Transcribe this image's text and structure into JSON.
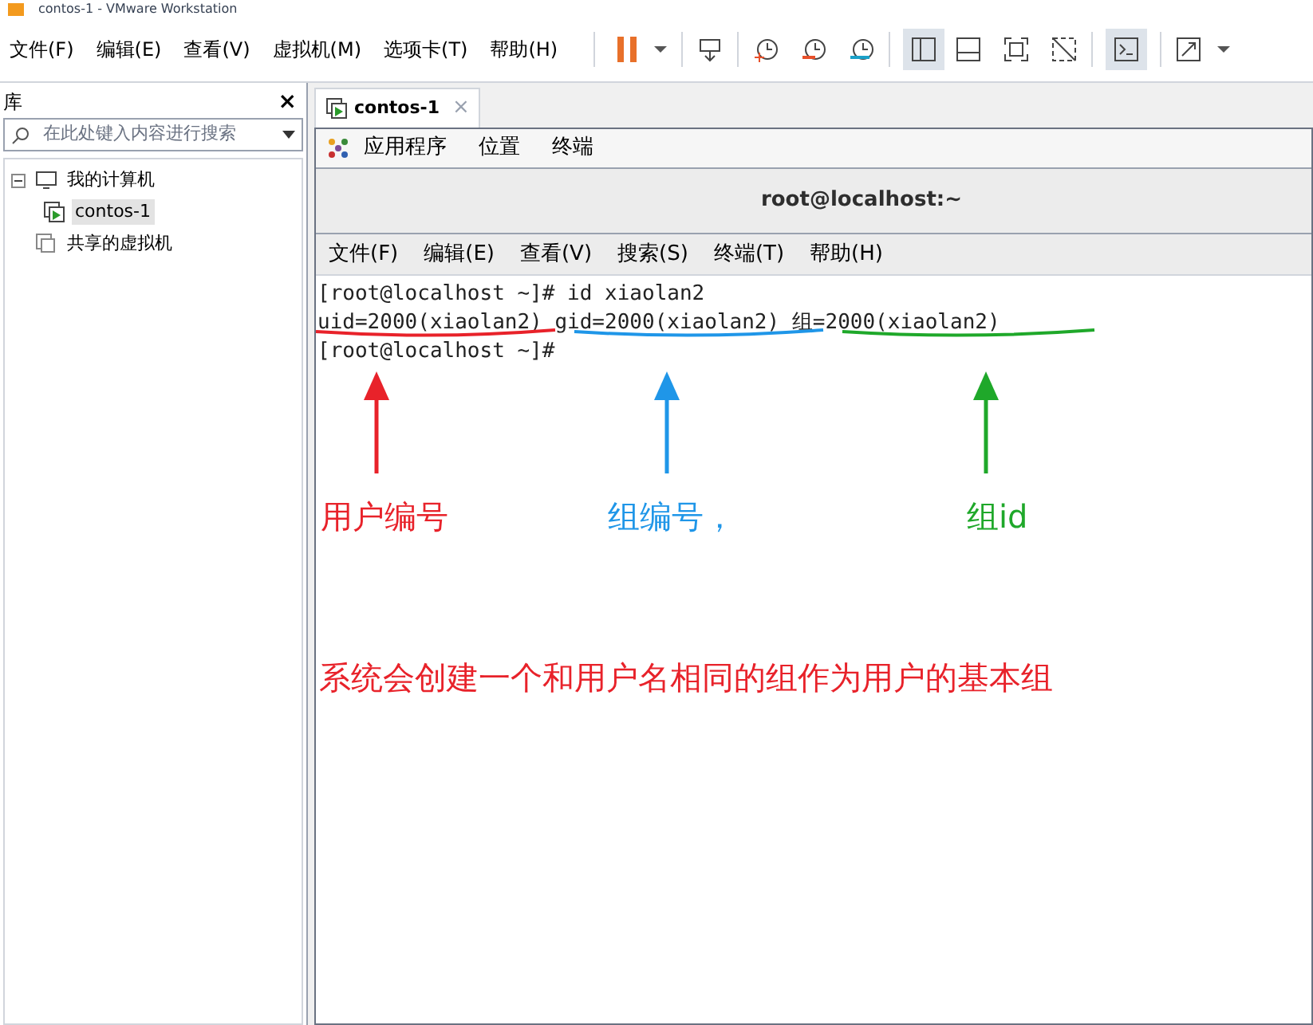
{
  "window": {
    "title": "contos-1 - VMware Workstation"
  },
  "menu": [
    "文件(F)",
    "编辑(E)",
    "查看(V)",
    "虚拟机(M)",
    "选项卡(T)",
    "帮助(H)"
  ],
  "library": {
    "title": "库",
    "close": "×",
    "search": {
      "placeholder": "在此处键入内容进行搜索"
    },
    "tree": [
      {
        "label": "我的计算机",
        "kind": "computer",
        "expanded": true,
        "selected": false,
        "children": [
          {
            "label": "contos-1",
            "kind": "vm",
            "selected": true
          }
        ]
      },
      {
        "label": "共享的虚拟机",
        "kind": "shared",
        "selected": false
      }
    ]
  },
  "tabs": [
    {
      "label": "contos-1",
      "selected": true,
      "close": "×"
    }
  ],
  "gnome_bar": [
    "应用程序",
    "位置",
    "终端"
  ],
  "terminal": {
    "title": "root@localhost:~",
    "menu": [
      "文件(F)",
      "编辑(E)",
      "查看(V)",
      "搜索(S)",
      "终端(T)",
      "帮助(H)"
    ],
    "lines": [
      "[root@localhost ~]# id xiaolan2",
      "uid=2000(xiaolan2) gid=2000(xiaolan2) 组=2000(xiaolan2)",
      "[root@localhost ~]#"
    ]
  },
  "annotations": [
    {
      "text": "用户编号",
      "color": "#e8222a"
    },
    {
      "text": "组编号，",
      "color": "#1f96e8"
    },
    {
      "text": "组id",
      "color": "#1fa82a"
    }
  ],
  "note": {
    "text": "系统会创建一个和用户名相同的组作为用户的基本组"
  }
}
